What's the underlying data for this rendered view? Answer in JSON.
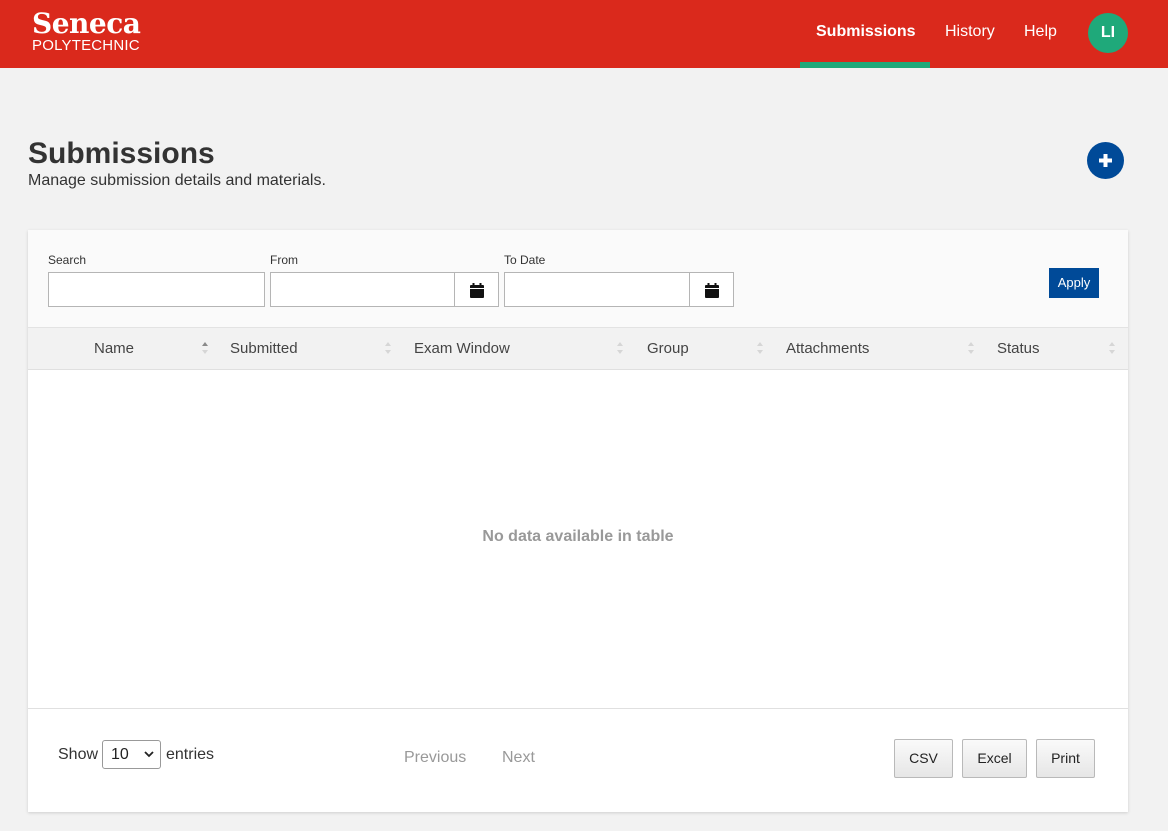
{
  "brand": {
    "name": "Seneca",
    "subname": "POLYTECHNIC"
  },
  "nav": {
    "items": [
      {
        "label": "Submissions",
        "active": true
      },
      {
        "label": "History",
        "active": false
      },
      {
        "label": "Help",
        "active": false
      }
    ],
    "avatar_initials": "LI"
  },
  "page": {
    "title": "Submissions",
    "subtitle": "Manage submission details and materials.",
    "add_icon": "plus-icon"
  },
  "filters": {
    "search_label": "Search",
    "search_value": "",
    "from_label": "From",
    "from_value": "",
    "to_label": "To Date",
    "to_value": "",
    "calendar_icon": "calendar-icon",
    "apply_label": "Apply"
  },
  "table": {
    "columns": [
      "Name",
      "Submitted",
      "Exam Window",
      "Group",
      "Attachments",
      "Status"
    ],
    "sorted_column": "Name",
    "empty_message": "No data available in table"
  },
  "footer": {
    "show_label": "Show",
    "entries_value": "10",
    "entries_label": "entries",
    "previous_label": "Previous",
    "next_label": "Next",
    "csv_label": "CSV",
    "excel_label": "Excel",
    "print_label": "Print"
  },
  "colors": {
    "header_red": "#da291c",
    "active_green": "#1fa97a",
    "primary_blue": "#004a98"
  }
}
